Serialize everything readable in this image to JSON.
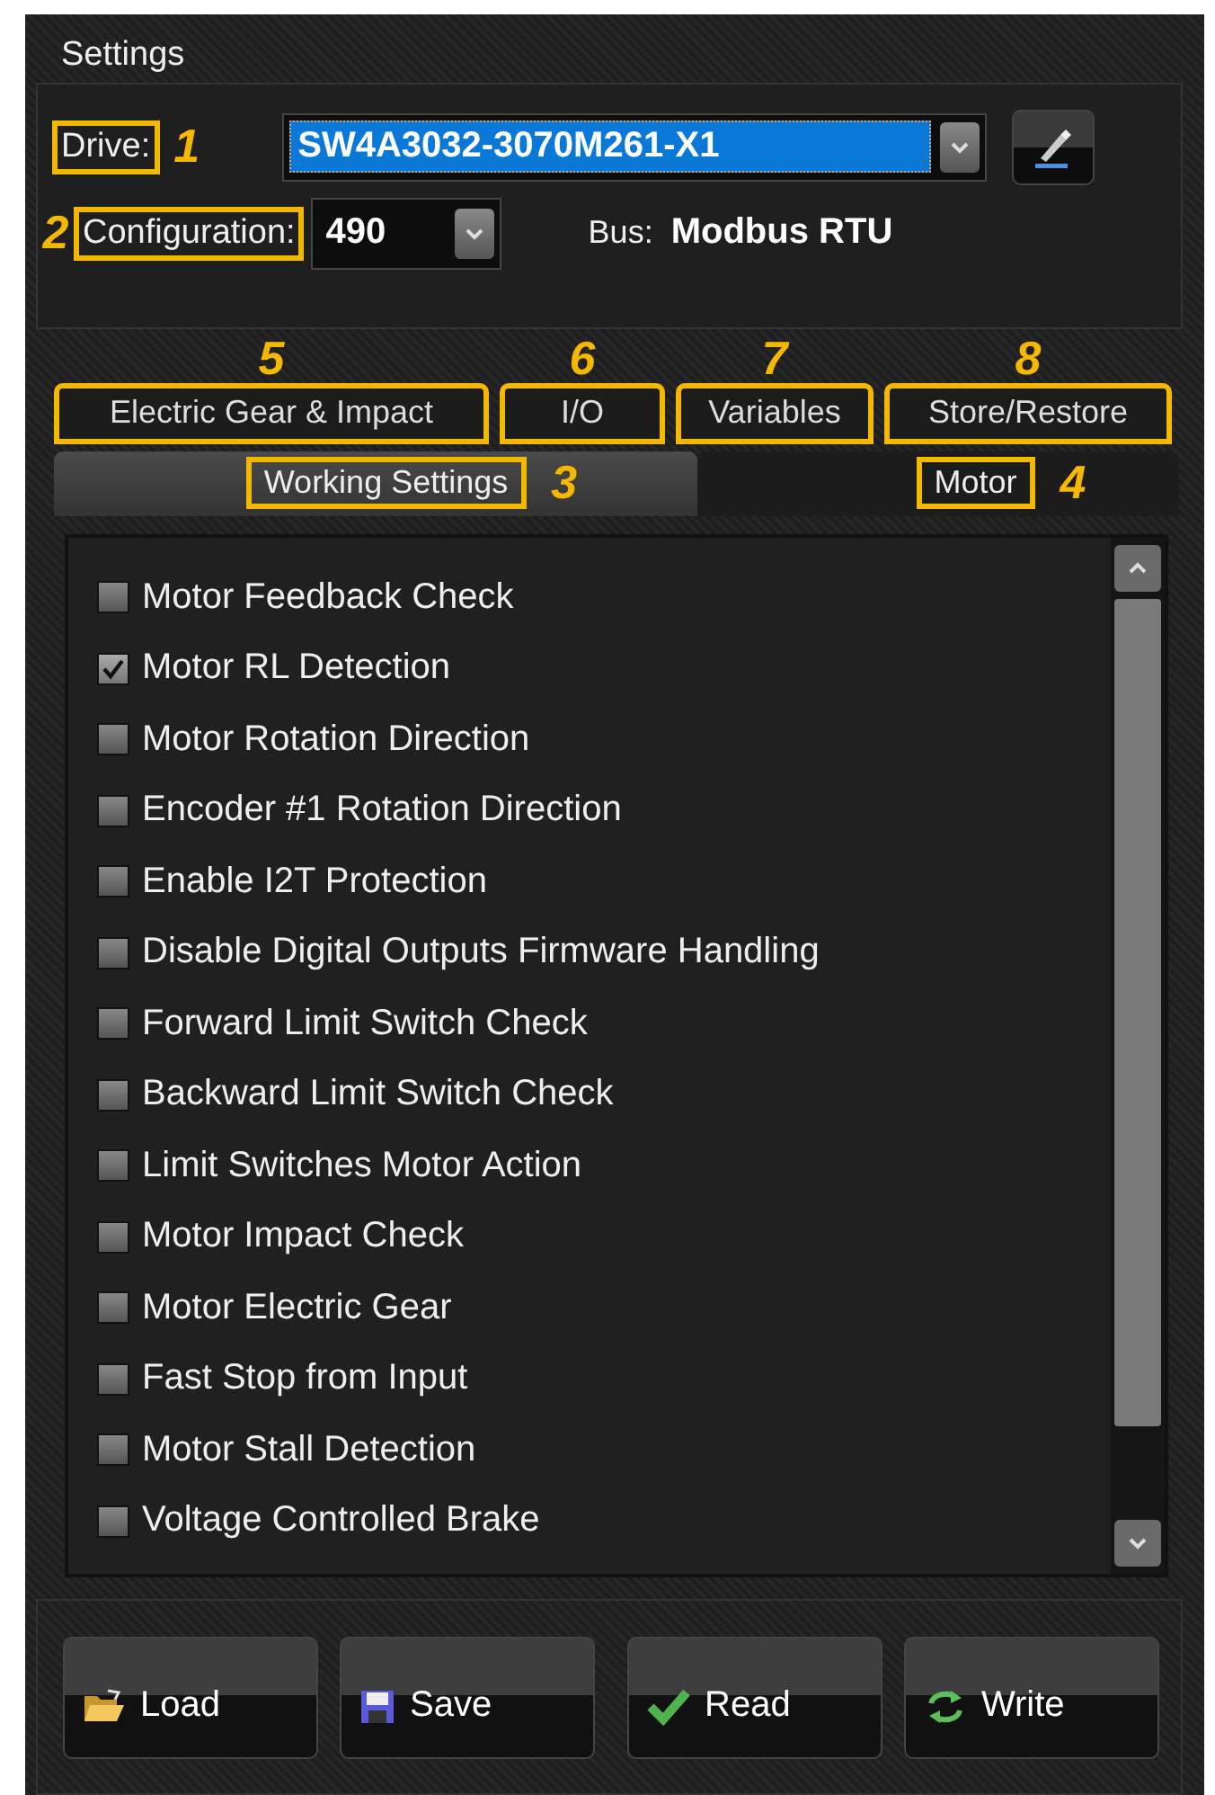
{
  "group_title": "Settings",
  "drive": {
    "label": "Drive:",
    "callout": "1",
    "value": "SW4A3032-3070M261-X1"
  },
  "configuration": {
    "label": "Configuration:",
    "callout": "2",
    "value": "490"
  },
  "bus": {
    "label": "Bus:",
    "value": "Modbus RTU"
  },
  "tabs_row_1": [
    {
      "label": "Electric Gear & Impact",
      "callout": "5",
      "selected": false
    },
    {
      "label": "I/O",
      "callout": "6",
      "selected": false
    },
    {
      "label": "Variables",
      "callout": "7",
      "selected": false
    },
    {
      "label": "Store/Restore",
      "callout": "8",
      "selected": false
    }
  ],
  "tabs_row_2": [
    {
      "label": "Working Settings",
      "callout": "3",
      "selected": true
    },
    {
      "label": "Motor",
      "callout": "4",
      "selected": false
    }
  ],
  "options": [
    {
      "label": "Motor Feedback Check",
      "checked": false
    },
    {
      "label": "Motor RL Detection",
      "checked": true
    },
    {
      "label": "Motor Rotation Direction",
      "checked": false
    },
    {
      "label": "Encoder #1 Rotation Direction",
      "checked": false
    },
    {
      "label": "Enable I2T Protection",
      "checked": false
    },
    {
      "label": "Disable Digital Outputs Firmware Handling",
      "checked": false
    },
    {
      "label": "Forward Limit Switch Check",
      "checked": false
    },
    {
      "label": "Backward Limit Switch Check",
      "checked": false
    },
    {
      "label": "Limit Switches Motor Action",
      "checked": false
    },
    {
      "label": "Motor Impact Check",
      "checked": false
    },
    {
      "label": "Motor Electric Gear",
      "checked": false
    },
    {
      "label": "Fast Stop from Input",
      "checked": false
    },
    {
      "label": "Motor Stall Detection",
      "checked": false
    },
    {
      "label": "Voltage Controlled Brake",
      "checked": false
    }
  ],
  "buttons": [
    {
      "label": "Load",
      "kind": "load"
    },
    {
      "label": "Save",
      "kind": "save"
    },
    {
      "label": "Read",
      "kind": "read"
    },
    {
      "label": "Write",
      "kind": "write"
    }
  ]
}
